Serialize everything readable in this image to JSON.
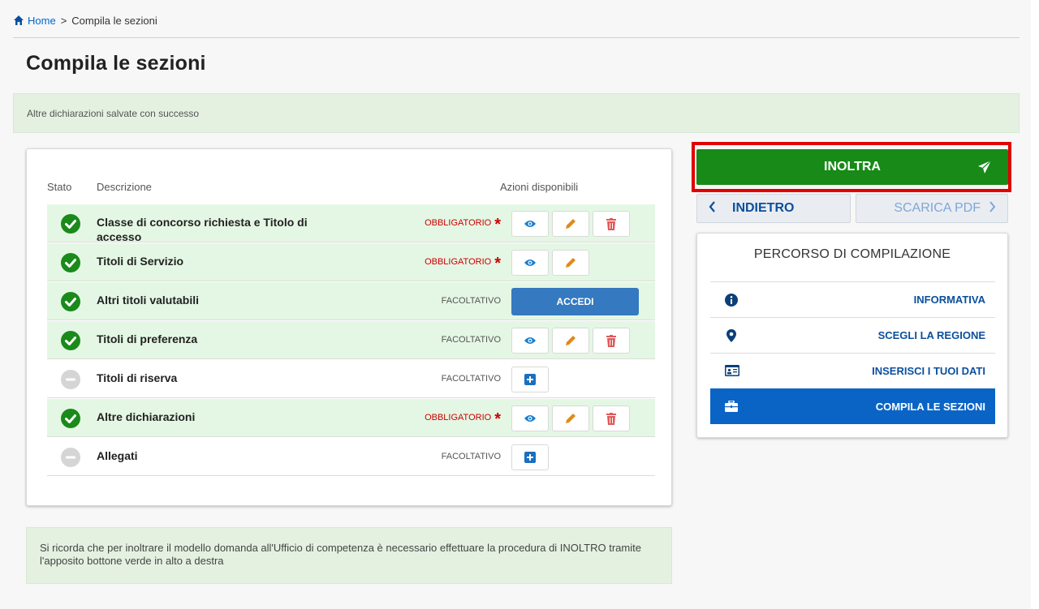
{
  "breadcrumb": {
    "home": "Home",
    "separator": ">",
    "current": "Compila le sezioni"
  },
  "page_title": "Compila le sezioni",
  "success_message": "Altre dichiarazioni salvate con successo",
  "table": {
    "headers": {
      "stato": "Stato",
      "descrizione": "Descrizione",
      "azioni": "Azioni disponibili"
    },
    "rows": [
      {
        "label": "Classe di concorso richiesta e Titolo di accesso",
        "status": "completed",
        "requirement": "OBBLIGATORIO",
        "mandatory": true,
        "actions": [
          "view-icon",
          "edit-icon",
          "delete-icon"
        ]
      },
      {
        "label": "Titoli di Servizio",
        "status": "completed",
        "requirement": "OBBLIGATORIO",
        "mandatory": true,
        "actions": [
          "view-icon",
          "edit-icon"
        ]
      },
      {
        "label": "Altri titoli valutabili",
        "status": "completed",
        "requirement": "FACOLTATIVO",
        "mandatory": false,
        "accedi_label": "ACCEDI"
      },
      {
        "label": "Titoli di preferenza",
        "status": "completed",
        "requirement": "FACOLTATIVO",
        "mandatory": false,
        "actions": [
          "view-icon",
          "edit-icon",
          "delete-icon"
        ]
      },
      {
        "label": "Titoli di riserva",
        "status": "empty",
        "requirement": "FACOLTATIVO",
        "mandatory": false,
        "actions": [
          "add-icon"
        ]
      },
      {
        "label": "Altre dichiarazioni",
        "status": "completed",
        "requirement": "OBBLIGATORIO",
        "mandatory": true,
        "actions": [
          "view-icon",
          "edit-icon",
          "delete-icon"
        ]
      },
      {
        "label": "Allegati",
        "status": "empty",
        "requirement": "FACOLTATIVO",
        "mandatory": false,
        "actions": [
          "add-icon"
        ]
      }
    ]
  },
  "note": "Si ricorda che per inoltrare il modello domanda all'Ufficio di competenza è necessario effettuare la procedura di INOLTRO tramite l'apposito bottone verde in alto a destra",
  "buttons": {
    "inoltra": "INOLTRA",
    "indietro": "INDIETRO",
    "scarica_pdf": "SCARICA PDF"
  },
  "percorso": {
    "title": "PERCORSO DI COMPILAZIONE",
    "items": [
      {
        "label": "INFORMATIVA",
        "icon": "info-icon",
        "active": false
      },
      {
        "label": "SCEGLI LA REGIONE",
        "icon": "map-marker-icon",
        "active": false
      },
      {
        "label": "INSERISCI I TUOI DATI",
        "icon": "id-card-icon",
        "active": false
      },
      {
        "label": "COMPILA LE SEZIONI",
        "icon": "briefcase-icon",
        "active": true
      }
    ]
  },
  "colors": {
    "success_green": "#178a17",
    "primary_blue": "#0a64c6",
    "mandatory_red": "#cc0000",
    "row_done_bg": "#e4f7e4",
    "highlight_red": "#e00000"
  }
}
